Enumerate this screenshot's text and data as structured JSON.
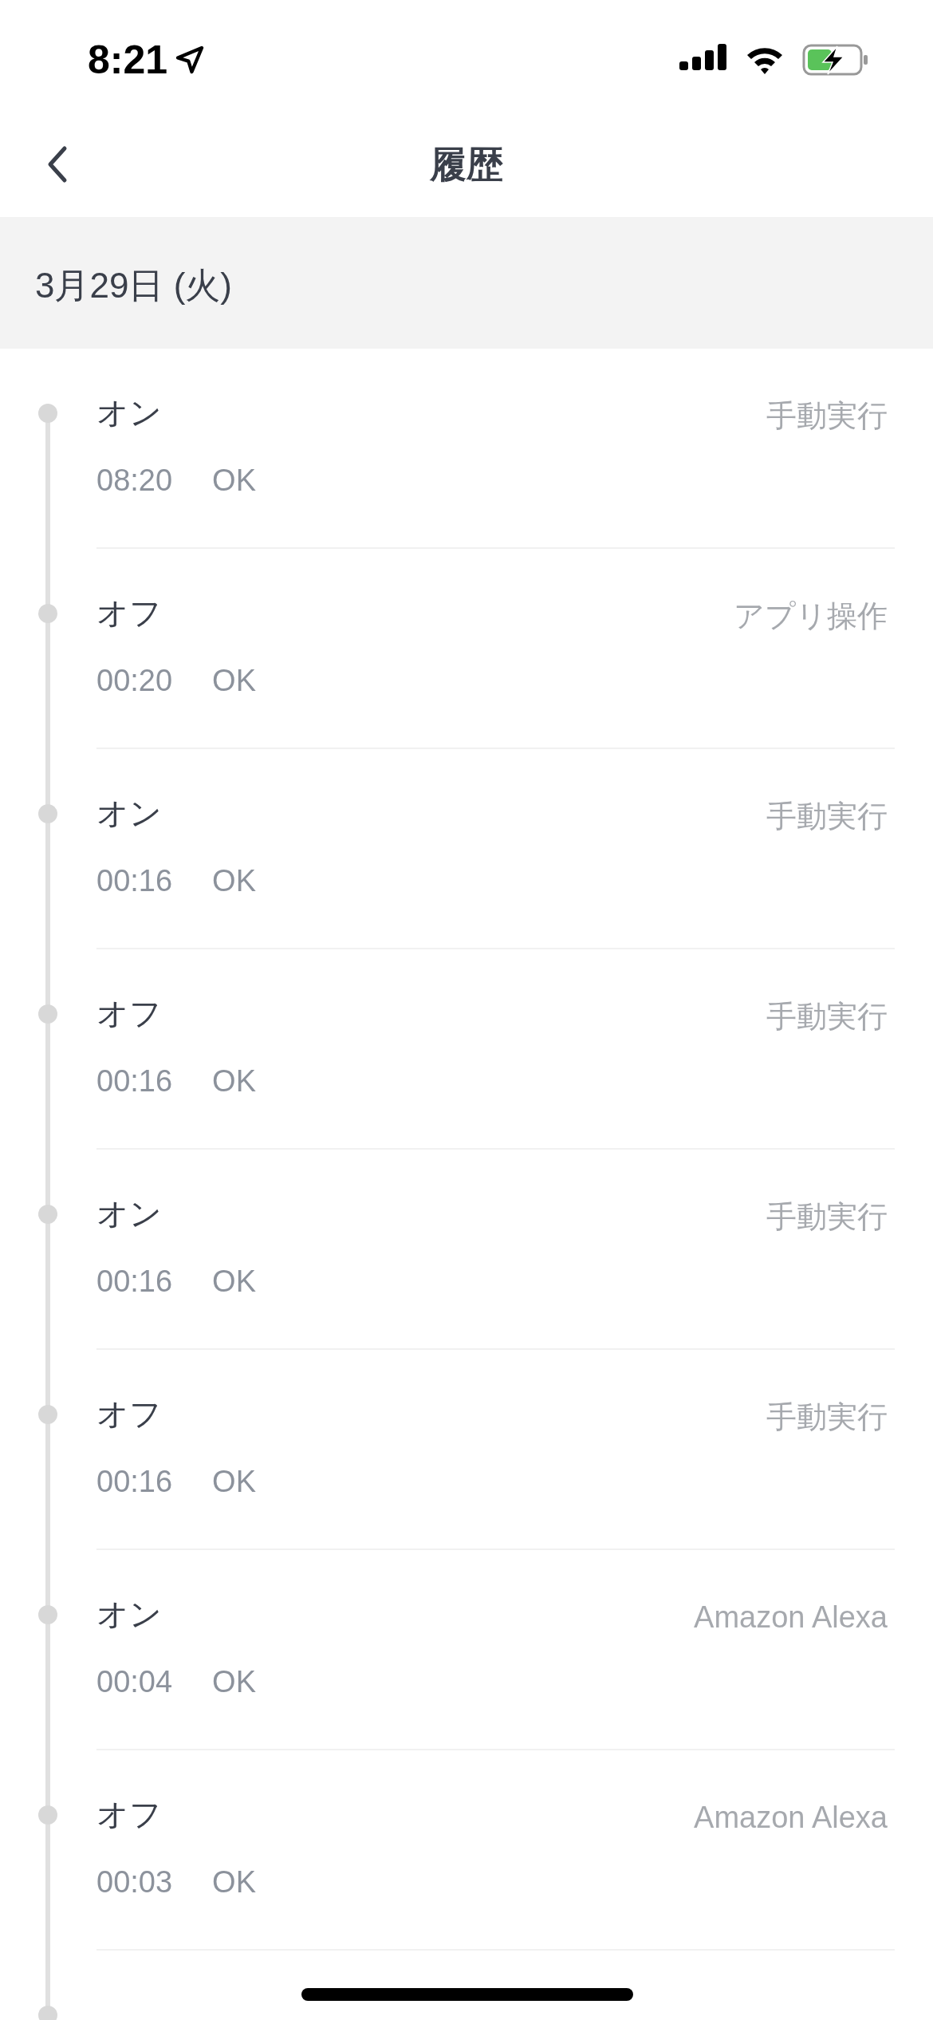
{
  "status_bar": {
    "time": "8:21"
  },
  "nav": {
    "title": "履歴"
  },
  "date_header": "3月29日 (火)",
  "entries": [
    {
      "action": "オン",
      "time": "08:20",
      "result": "OK",
      "source": "手動実行"
    },
    {
      "action": "オフ",
      "time": "00:20",
      "result": "OK",
      "source": "アプリ操作"
    },
    {
      "action": "オン",
      "time": "00:16",
      "result": "OK",
      "source": "手動実行"
    },
    {
      "action": "オフ",
      "time": "00:16",
      "result": "OK",
      "source": "手動実行"
    },
    {
      "action": "オン",
      "time": "00:16",
      "result": "OK",
      "source": "手動実行"
    },
    {
      "action": "オフ",
      "time": "00:16",
      "result": "OK",
      "source": "手動実行"
    },
    {
      "action": "オン",
      "time": "00:04",
      "result": "OK",
      "source": "Amazon Alexa"
    },
    {
      "action": "オフ",
      "time": "00:03",
      "result": "OK",
      "source": "Amazon Alexa"
    }
  ]
}
